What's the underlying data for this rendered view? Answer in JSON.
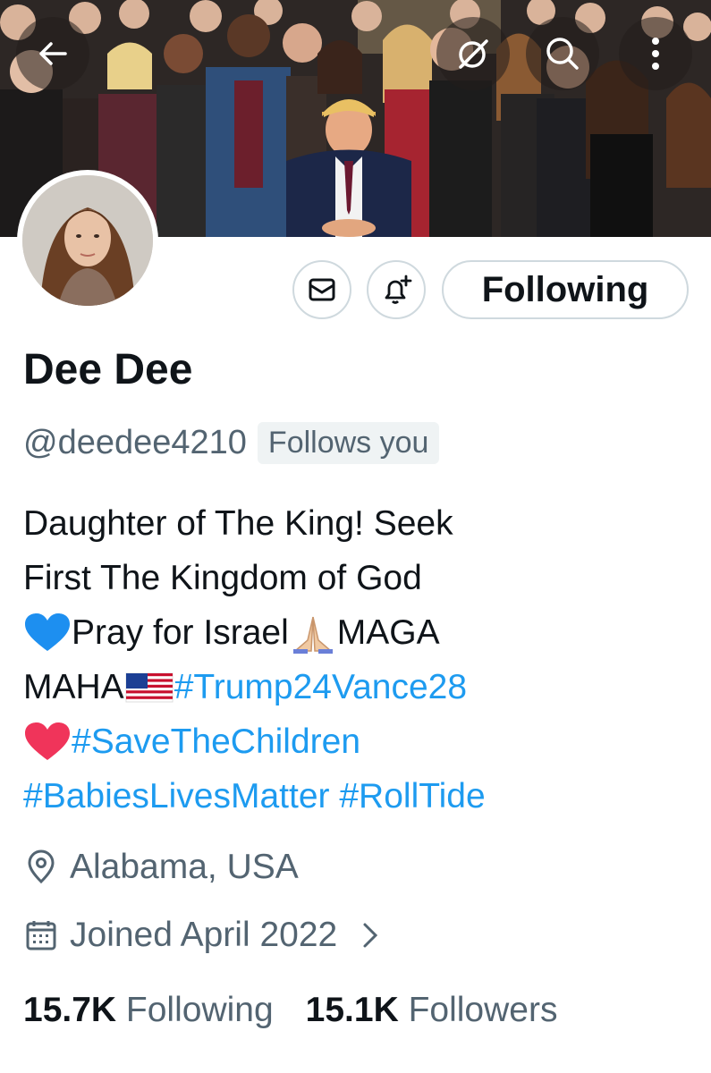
{
  "profile": {
    "display_name": "Dee Dee",
    "handle": "@deedee4210",
    "follows_you": "Follows you",
    "follow_button": "Following"
  },
  "bio": {
    "line1": "Daughter of The King! Seek",
    "line2": "First The Kingdom of God",
    "line3a": "Pray for Israel",
    "line3b": "MAGA",
    "line4a": "MAHA",
    "line4b": "#Trump24Vance28",
    "line5": "#SaveTheChildren",
    "line6a": "#BabiesLivesMatter",
    "line6b": "#RollTide"
  },
  "meta": {
    "location": "Alabama, USA",
    "joined": "Joined April 2022"
  },
  "stats": {
    "following_count": "15.7K",
    "following_label": "Following",
    "followers_count": "15.1K",
    "followers_label": "Followers"
  },
  "colors": {
    "accent": "#1d9bf0",
    "secondary_text": "#536471",
    "border": "#cfd9de"
  },
  "icons": [
    "back-arrow-icon",
    "grok-icon",
    "search-icon",
    "more-icon",
    "mail-icon",
    "bell-plus-icon",
    "location-pin-icon",
    "calendar-icon",
    "chevron-right-icon"
  ]
}
